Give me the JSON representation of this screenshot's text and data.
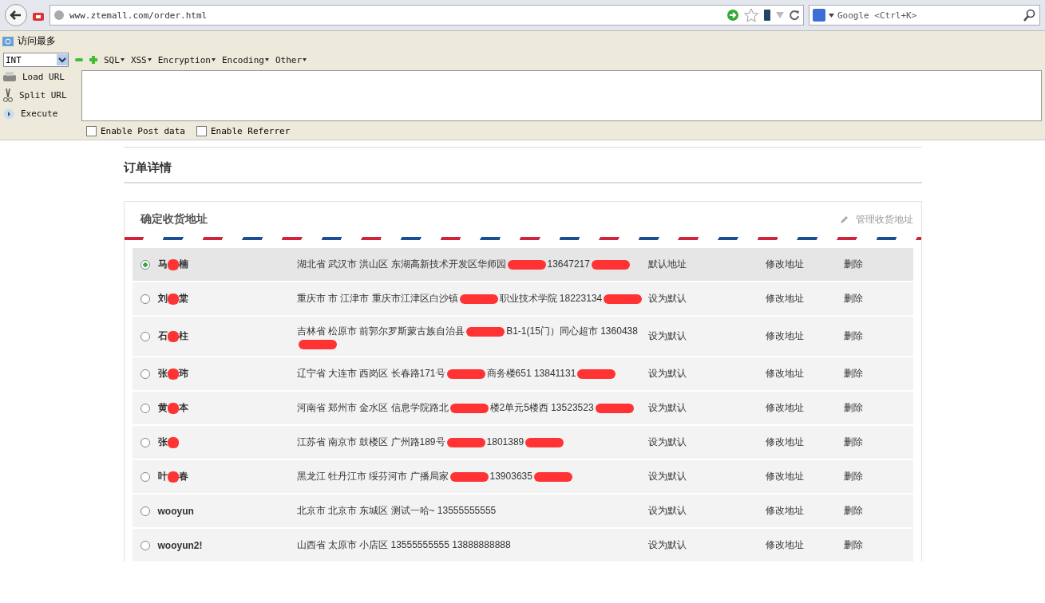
{
  "browser": {
    "url": "www.ztemall.com/order.html",
    "search_placeholder": "Google <Ctrl+K>"
  },
  "bookmarks": [
    {
      "label": "访问最多"
    }
  ],
  "hackbar": {
    "select": "INT",
    "menus": [
      "SQL",
      "XSS",
      "Encryption",
      "Encoding",
      "Other"
    ],
    "actions": [
      {
        "kind": "load",
        "label": "Load URL"
      },
      {
        "kind": "split",
        "label": "Split URL"
      },
      {
        "kind": "execute",
        "label": "Execute"
      }
    ],
    "options": [
      {
        "label": "Enable Post data",
        "checked": false
      },
      {
        "label": "Enable Referrer",
        "checked": false
      }
    ]
  },
  "page": {
    "title": "订单详情",
    "panel_title": "确定收货地址",
    "manage_link": "管理收货地址",
    "addresses": [
      {
        "selected": true,
        "name": [
          "马",
          "楠"
        ],
        "address": [
          "湖北省 武汉市 洪山区 东湖高新技术开发区华师园",
          "13647217"
        ],
        "default_action": "默认地址",
        "edit": "修改地址",
        "delete": "删除"
      },
      {
        "selected": false,
        "name": [
          "刘",
          "棠"
        ],
        "address": [
          "重庆市 市 江津市 重庆市江津区白沙镇",
          "职业技术学院 18223134"
        ],
        "default_action": "设为默认",
        "edit": "修改地址",
        "delete": "删除"
      },
      {
        "selected": false,
        "name": [
          "石",
          "柱"
        ],
        "address": [
          "吉林省 松原市 前郭尔罗斯蒙古族自治县",
          "B1-1(15门）同心超市 1360438"
        ],
        "default_action": "设为默认",
        "edit": "修改地址",
        "delete": "删除"
      },
      {
        "selected": false,
        "name": [
          "张",
          "玮"
        ],
        "address": [
          "辽宁省 大连市 西岗区 长春路171号",
          "商务楼651 13841131"
        ],
        "default_action": "设为默认",
        "edit": "修改地址",
        "delete": "删除"
      },
      {
        "selected": false,
        "name": [
          "黄",
          "本"
        ],
        "address": [
          "河南省 郑州市 金水区 信息学院路北",
          "楼2单元5楼西 13523523"
        ],
        "default_action": "设为默认",
        "edit": "修改地址",
        "delete": "删除"
      },
      {
        "selected": false,
        "name": [
          "张"
        ],
        "address": [
          "江苏省 南京市 鼓楼区 广州路189号",
          "1801389"
        ],
        "default_action": "设为默认",
        "edit": "修改地址",
        "delete": "删除"
      },
      {
        "selected": false,
        "name": [
          "叶",
          "春"
        ],
        "address": [
          "黑龙江 牡丹江市 绥芬河市 广播局家",
          "13903635"
        ],
        "default_action": "设为默认",
        "edit": "修改地址",
        "delete": "删除"
      },
      {
        "selected": false,
        "name": [
          "wooyun"
        ],
        "address": [
          "北京市 北京市 东城区 测试一哈~ 13555555555"
        ],
        "default_action": "设为默认",
        "edit": "修改地址",
        "delete": "删除"
      },
      {
        "selected": false,
        "name": [
          "wooyun2!"
        ],
        "address": [
          "山西省 太原市 小店区 13555555555 13888888888"
        ],
        "default_action": "设为默认",
        "edit": "修改地址",
        "delete": "删除"
      }
    ]
  }
}
